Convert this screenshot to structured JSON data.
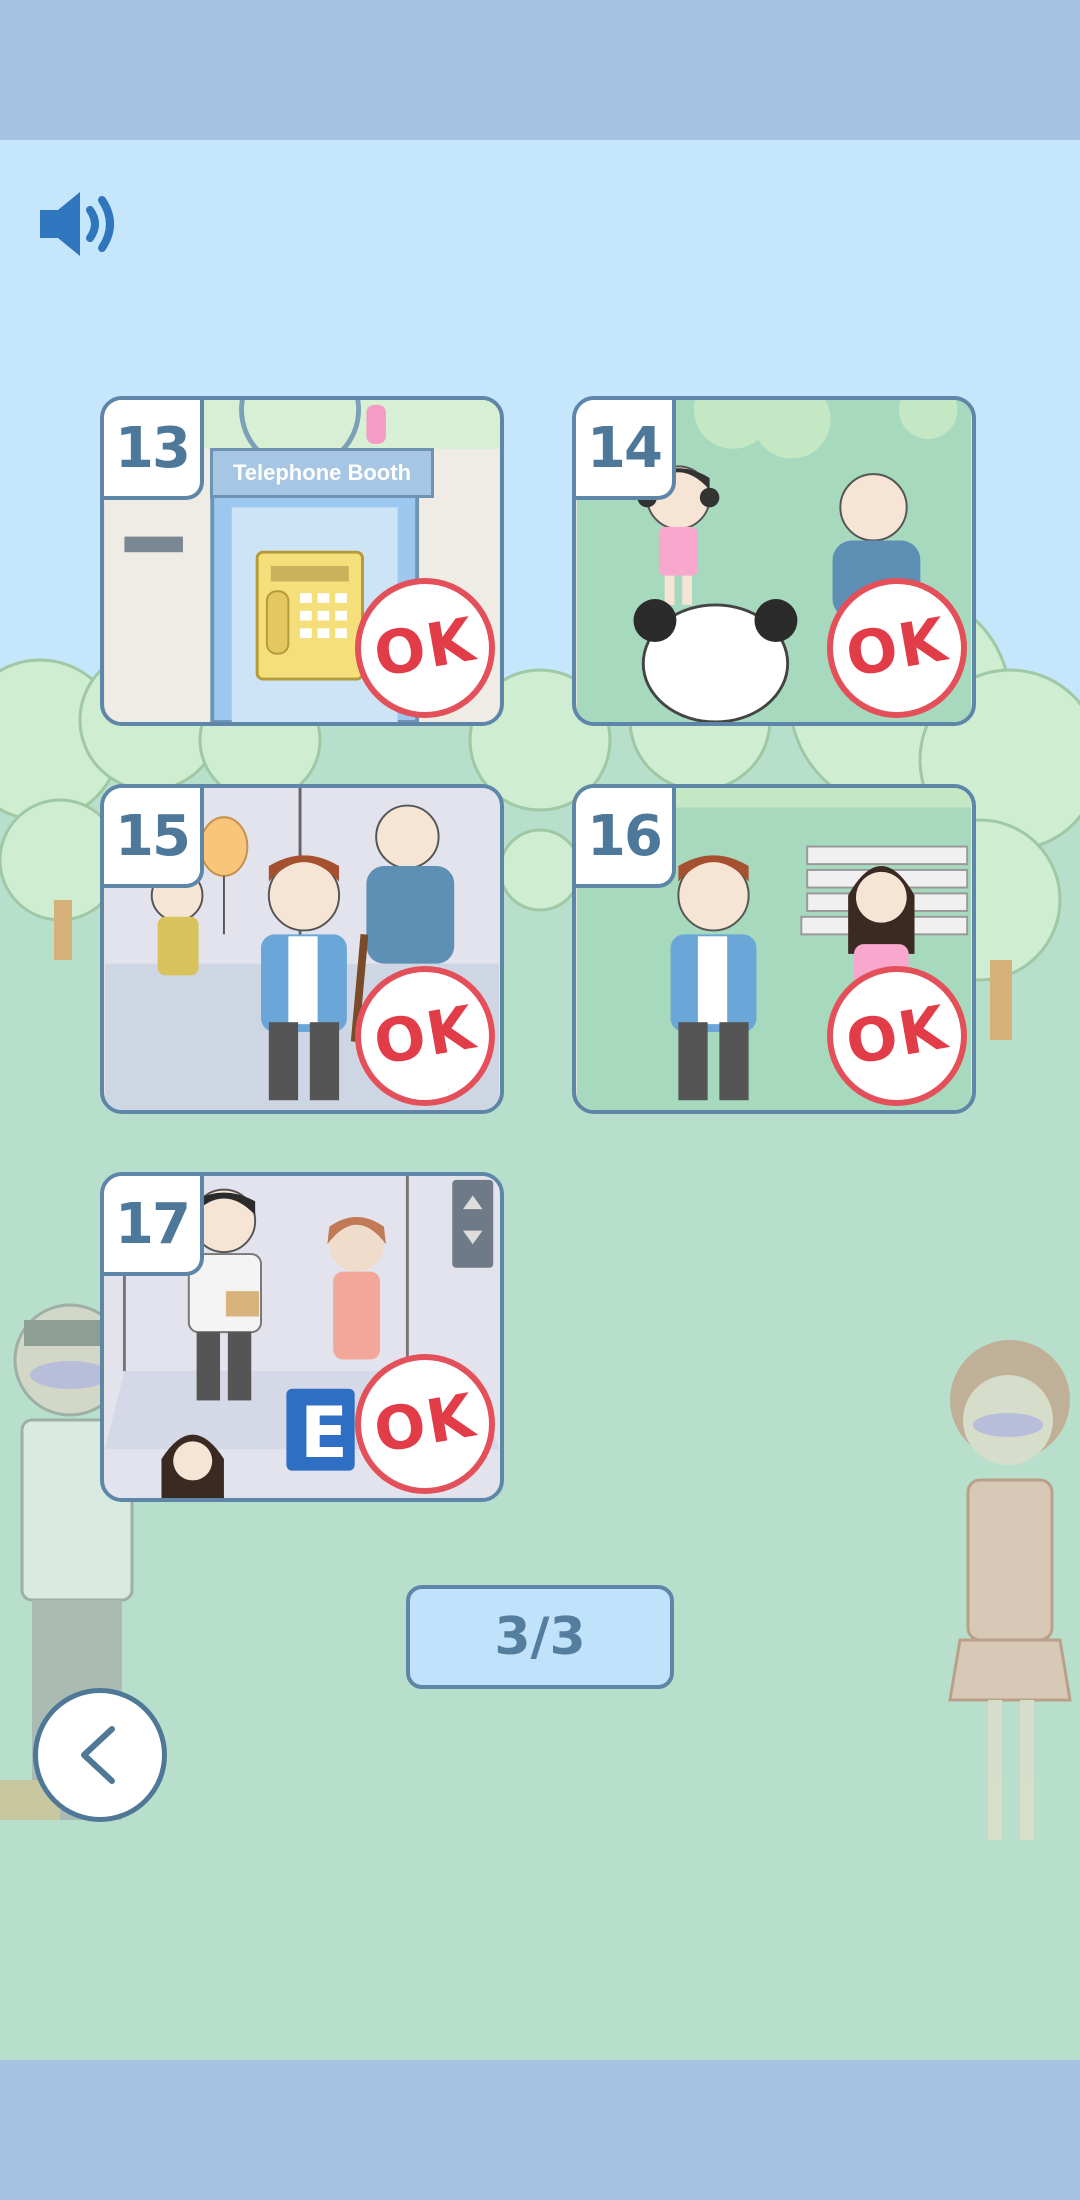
{
  "sound": {
    "icon": "speaker-icon",
    "state": "on"
  },
  "levels": [
    {
      "number": "13",
      "status": "OK",
      "scene_text": "Telephone Booth"
    },
    {
      "number": "14",
      "status": "OK"
    },
    {
      "number": "15",
      "status": "OK"
    },
    {
      "number": "16",
      "status": "OK"
    },
    {
      "number": "17",
      "status": "OK",
      "scene_text": "E"
    }
  ],
  "pagination": {
    "label": "3/3"
  },
  "back": {
    "icon": "chevron-left-icon"
  },
  "colors": {
    "bar": "#a7c3e3",
    "sky": "#c5e6fb",
    "grass": "#b7dfcb",
    "frame": "#5e86a8",
    "ok_red": "#e23c48"
  }
}
